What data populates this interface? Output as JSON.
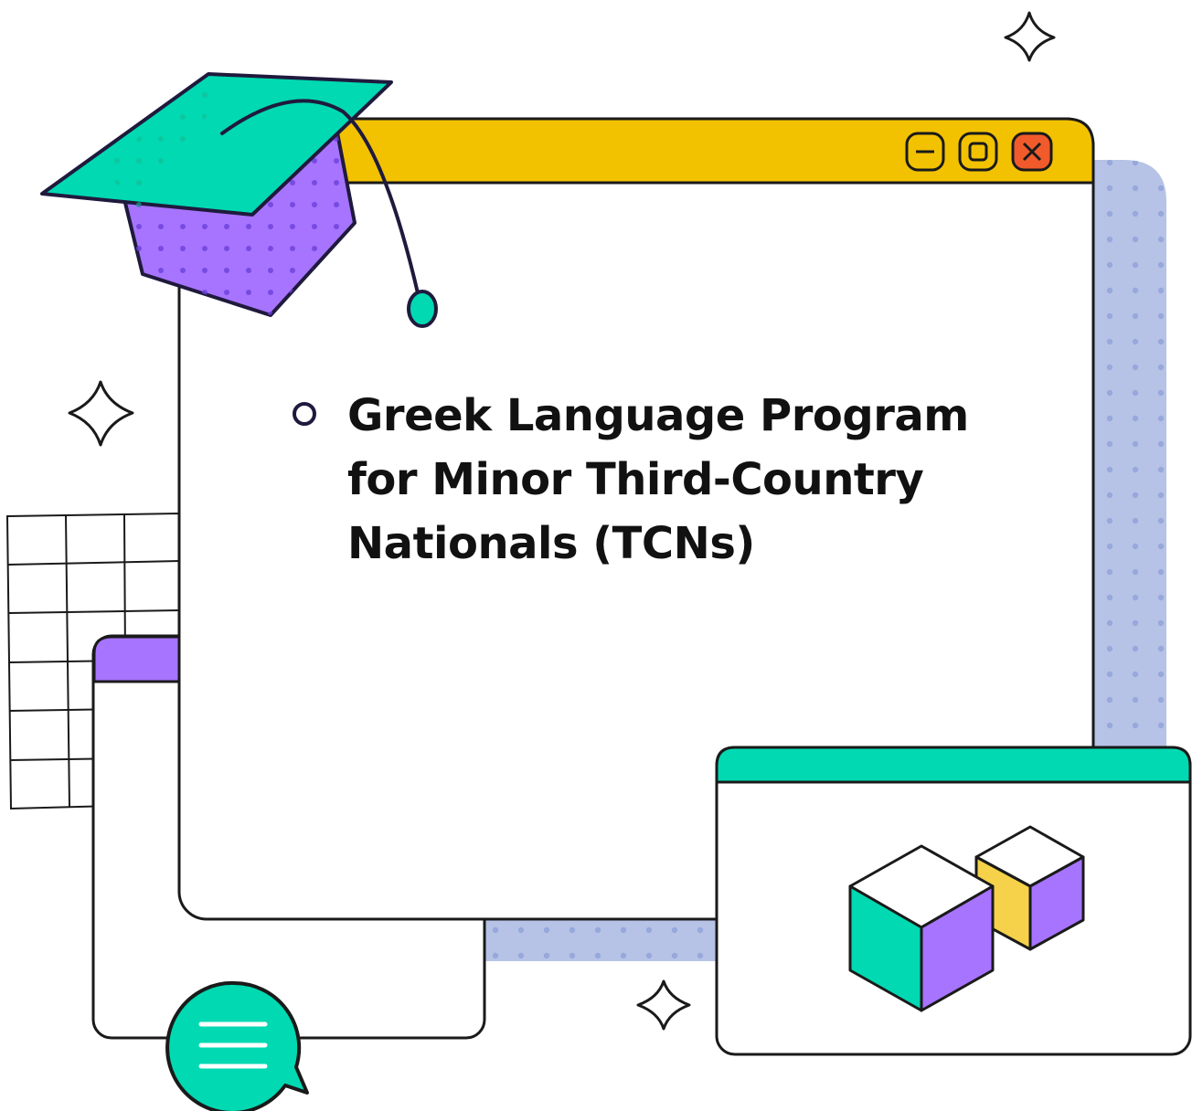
{
  "window": {
    "title_lines": [
      "Greek Language Program",
      "for Minor Third-Country",
      "Nationals (TCNs)"
    ],
    "controls": [
      "minimize-icon",
      "maximize-icon",
      "close-icon"
    ]
  },
  "colors": {
    "titlebar": "#f2c200",
    "teal": "#00d9b2",
    "purple": "#a774ff",
    "dots": "#b6c3e6",
    "close": "#f15a2b",
    "outline": "#1f1a3d"
  },
  "decor": {
    "icons": [
      "graduation-cap-icon",
      "sparkle-icon",
      "chat-bubble-icon",
      "cube-icon",
      "grid-pattern"
    ]
  }
}
